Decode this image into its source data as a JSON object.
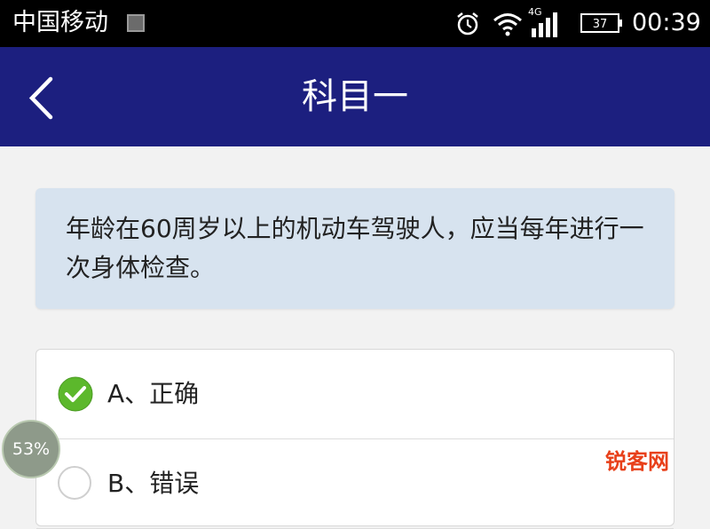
{
  "status_bar": {
    "carrier": "中国移动",
    "network": "4G",
    "battery": "37",
    "time": "00:39"
  },
  "header": {
    "title": "科目一",
    "back_icon": "chevron-left-icon"
  },
  "question": {
    "text": "年龄在60周岁以上的机动车驾驶人，应当每年进行一次身体检查。"
  },
  "options": [
    {
      "label": "A、正确",
      "selected": true,
      "icon": "check-circle-icon"
    },
    {
      "label": "B、错误",
      "selected": false,
      "icon": "radio-empty-icon"
    }
  ],
  "progress": {
    "label": "53%"
  },
  "watermark": {
    "text": "锐客网"
  },
  "colors": {
    "header_bg": "#1c1f7f",
    "question_bg": "#d7e3ef",
    "check_green": "#5cb82c",
    "watermark": "#e8401a"
  }
}
